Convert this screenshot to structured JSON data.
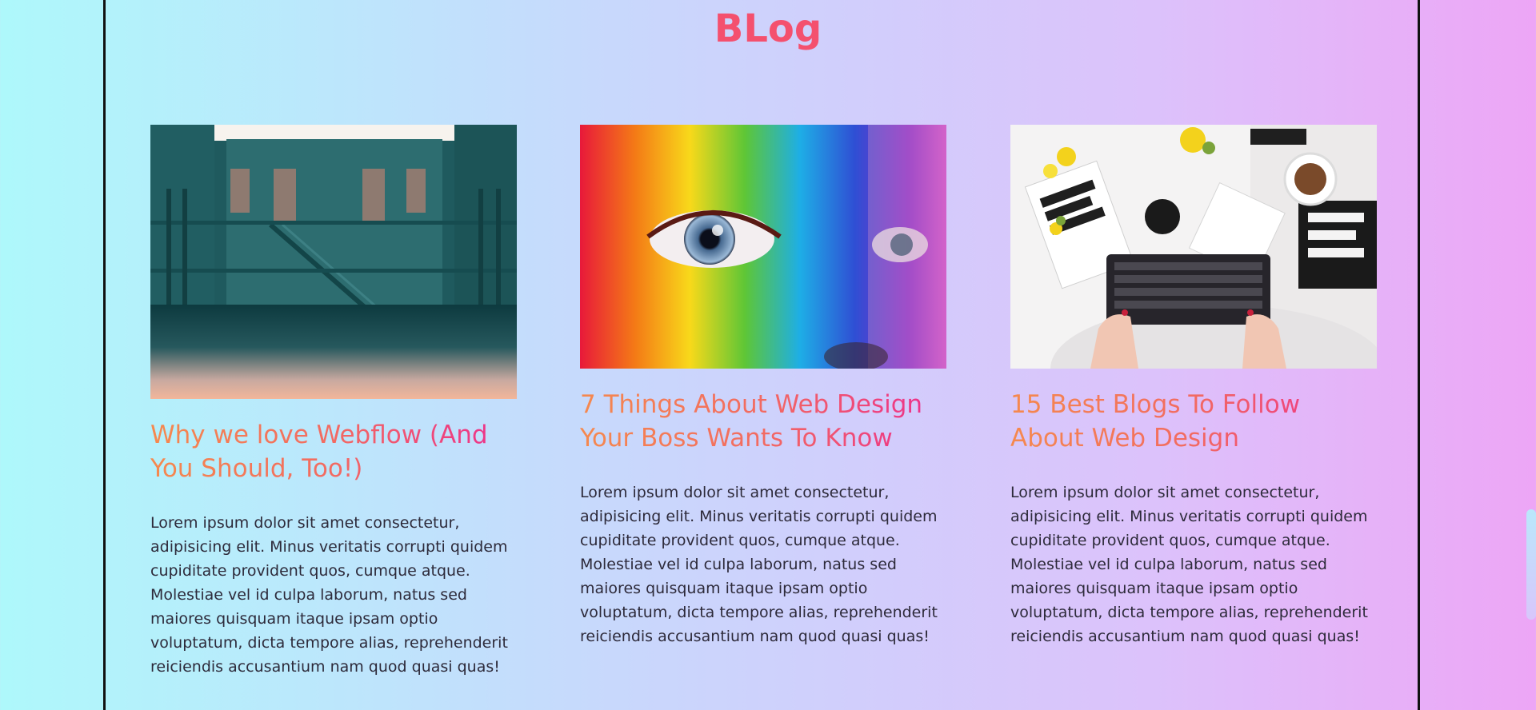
{
  "page": {
    "title": "BLog"
  },
  "cards": [
    {
      "image_alt": "Teal building courtyard with staircase",
      "heading": "Why we love Webflow (And You Should, Too!)",
      "body": "Lorem ipsum dolor sit amet consectetur, adipisicing elit. Minus veritatis corrupti quidem cupiditate provident quos, cumque atque. Molestiae vel id culpa laborum, natus sed maiores quisquam itaque ipsam optio voluptatum, dicta tempore alias, reprehenderit reiciendis accusantium nam quod quasi quas!"
    },
    {
      "image_alt": "Face painted in rainbow colors",
      "heading": "7 Things About Web Design Your Boss Wants To Know",
      "body": "Lorem ipsum dolor sit amet consectetur, adipisicing elit. Minus veritatis corrupti quidem cupiditate provident quos, cumque atque. Molestiae vel id culpa laborum, natus sed maiores quisquam itaque ipsam optio voluptatum, dicta tempore alias, reprehenderit reiciendis accusantium nam quod quasi quas!"
    },
    {
      "image_alt": "Desk with keyboard, coffee and magazines",
      "heading": "15 Best Blogs To Follow About Web Design",
      "body": "Lorem ipsum dolor sit amet consectetur, adipisicing elit. Minus veritatis corrupti quidem cupiditate provident quos, cumque atque. Molestiae vel id culpa laborum, natus sed maiores quisquam itaque ipsam optio voluptatum, dicta tempore alias, reprehenderit reiciendis accusantium nam quod quasi quas!"
    }
  ],
  "colors": {
    "title": "#f4506e",
    "heading_gradient_start": "#f5894e",
    "heading_gradient_end": "#ec2b8f",
    "body_text": "#2d2a3a"
  }
}
